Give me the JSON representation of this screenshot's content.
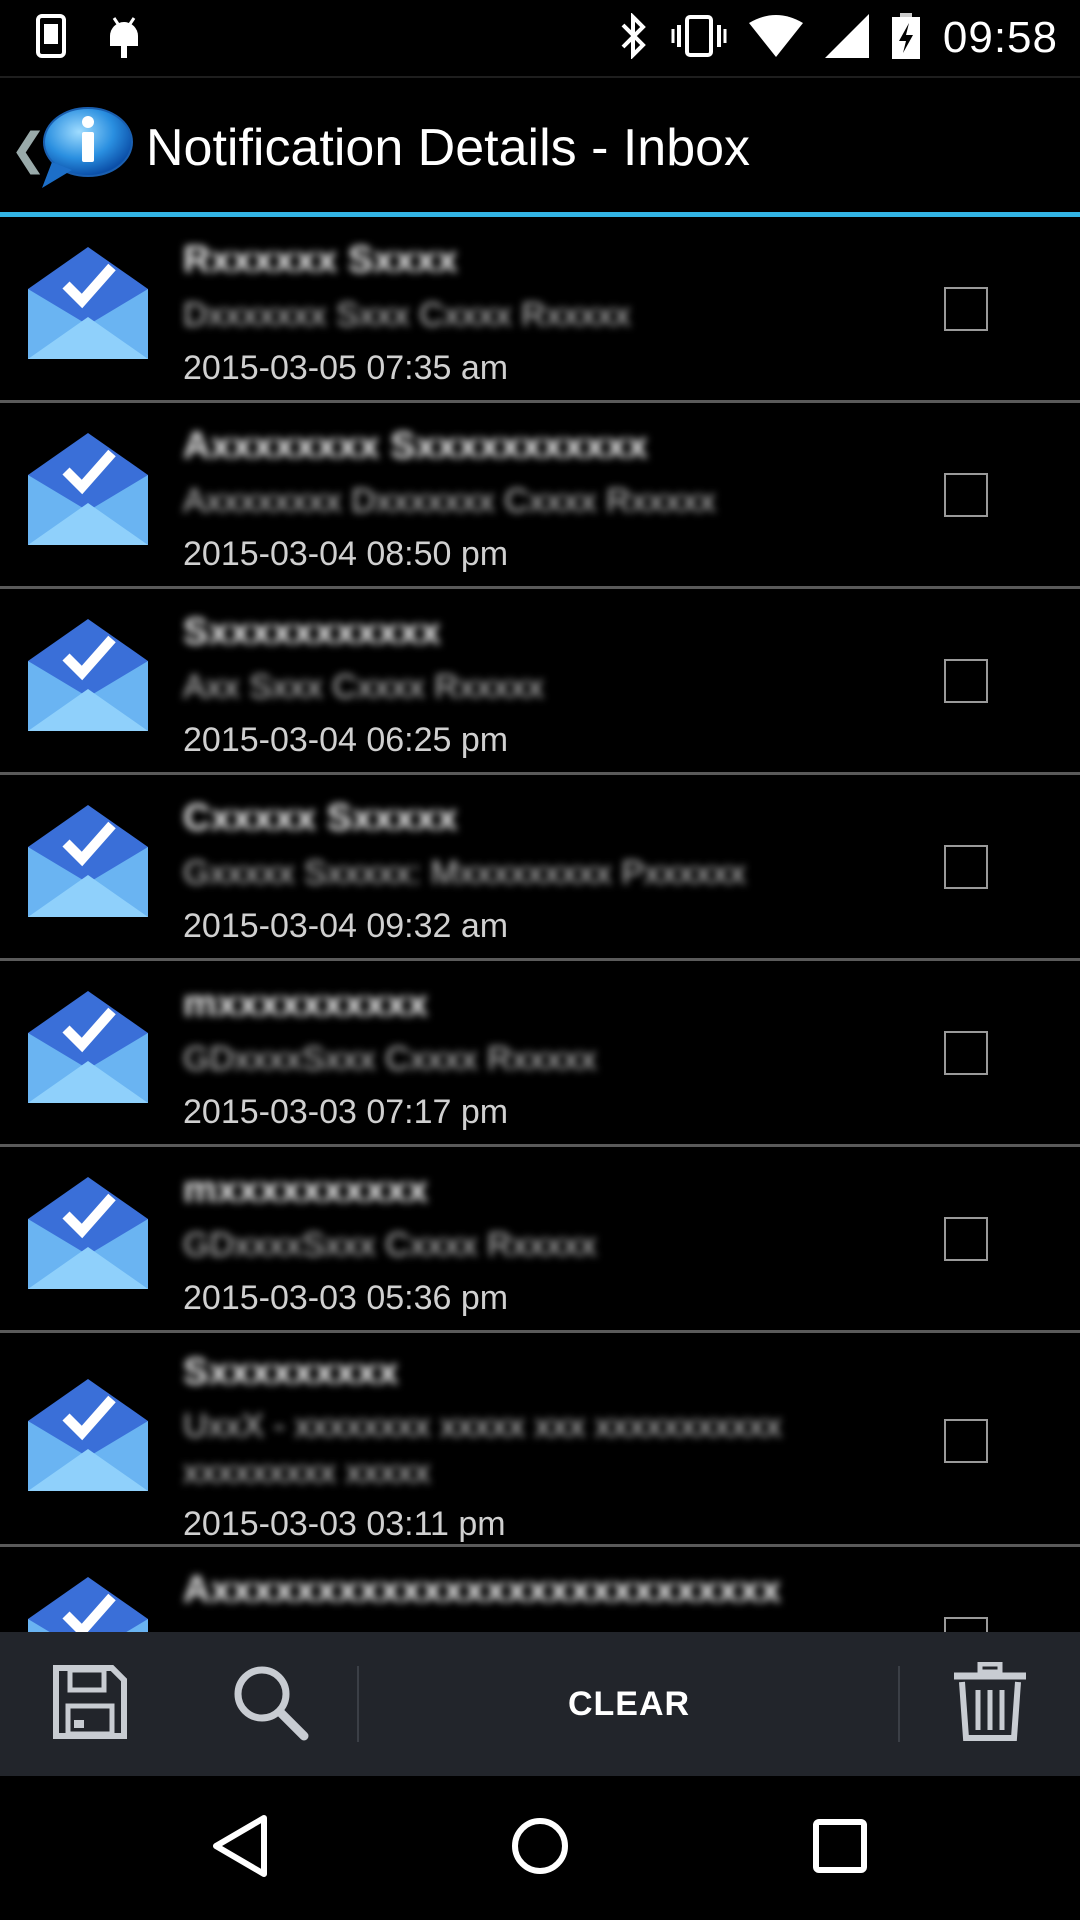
{
  "status_bar": {
    "left_icons": [
      "phone-screen-icon",
      "android-debug-icon"
    ],
    "right_icons": [
      "bluetooth-icon",
      "vibrate-icon",
      "wifi-icon",
      "signal-icon",
      "battery-charging-icon"
    ],
    "time": "09:58"
  },
  "action_bar": {
    "title": "Notification Details - Inbox",
    "accent_color": "#33b5e5"
  },
  "notifications": [
    {
      "sender": "Rxxxxxx Sxxxx",
      "subject": "Dxxxxxxx Sxxx Cxxxx Rxxxxx",
      "date": "2015-03-05 07:35 am"
    },
    {
      "sender": "Axxxxxxxx Sxxxxxxxxxxx",
      "subject": "Axxxxxxxx Dxxxxxxx Cxxxx Rxxxxx",
      "date": "2015-03-04 08:50 pm"
    },
    {
      "sender": "Sxxxxxxxxxxx",
      "subject": "Axx Sxxx Cxxxx Rxxxxx",
      "date": "2015-03-04 06:25 pm"
    },
    {
      "sender": "Cxxxxx Sxxxxx",
      "subject": "Gxxxxx Sxxxxx: Mxxxxxxxxx Pxxxxxx",
      "date": "2015-03-04 09:32 am"
    },
    {
      "sender": "mxxxxxxxxxx",
      "subject": "GDxxxxSxxx Cxxxx Rxxxxx",
      "date": "2015-03-03 07:17 pm"
    },
    {
      "sender": "mxxxxxxxxxx",
      "subject": "GDxxxxSxxx Cxxxx Rxxxxx",
      "date": "2015-03-03 05:36 pm"
    },
    {
      "sender": "Sxxxxxxxxx",
      "subject": "UxxX - xxxxxxxx xxxxx xxx xxxxxxxxxxx xxxxxxxxx xxxxx",
      "date": "2015-03-03 03:11 pm"
    },
    {
      "sender": "Axxxxxxxxxxxxxxxxxxxxxxxxxxx",
      "subject": "",
      "date": ""
    }
  ],
  "toolbar": {
    "clear_label": "CLEAR"
  }
}
